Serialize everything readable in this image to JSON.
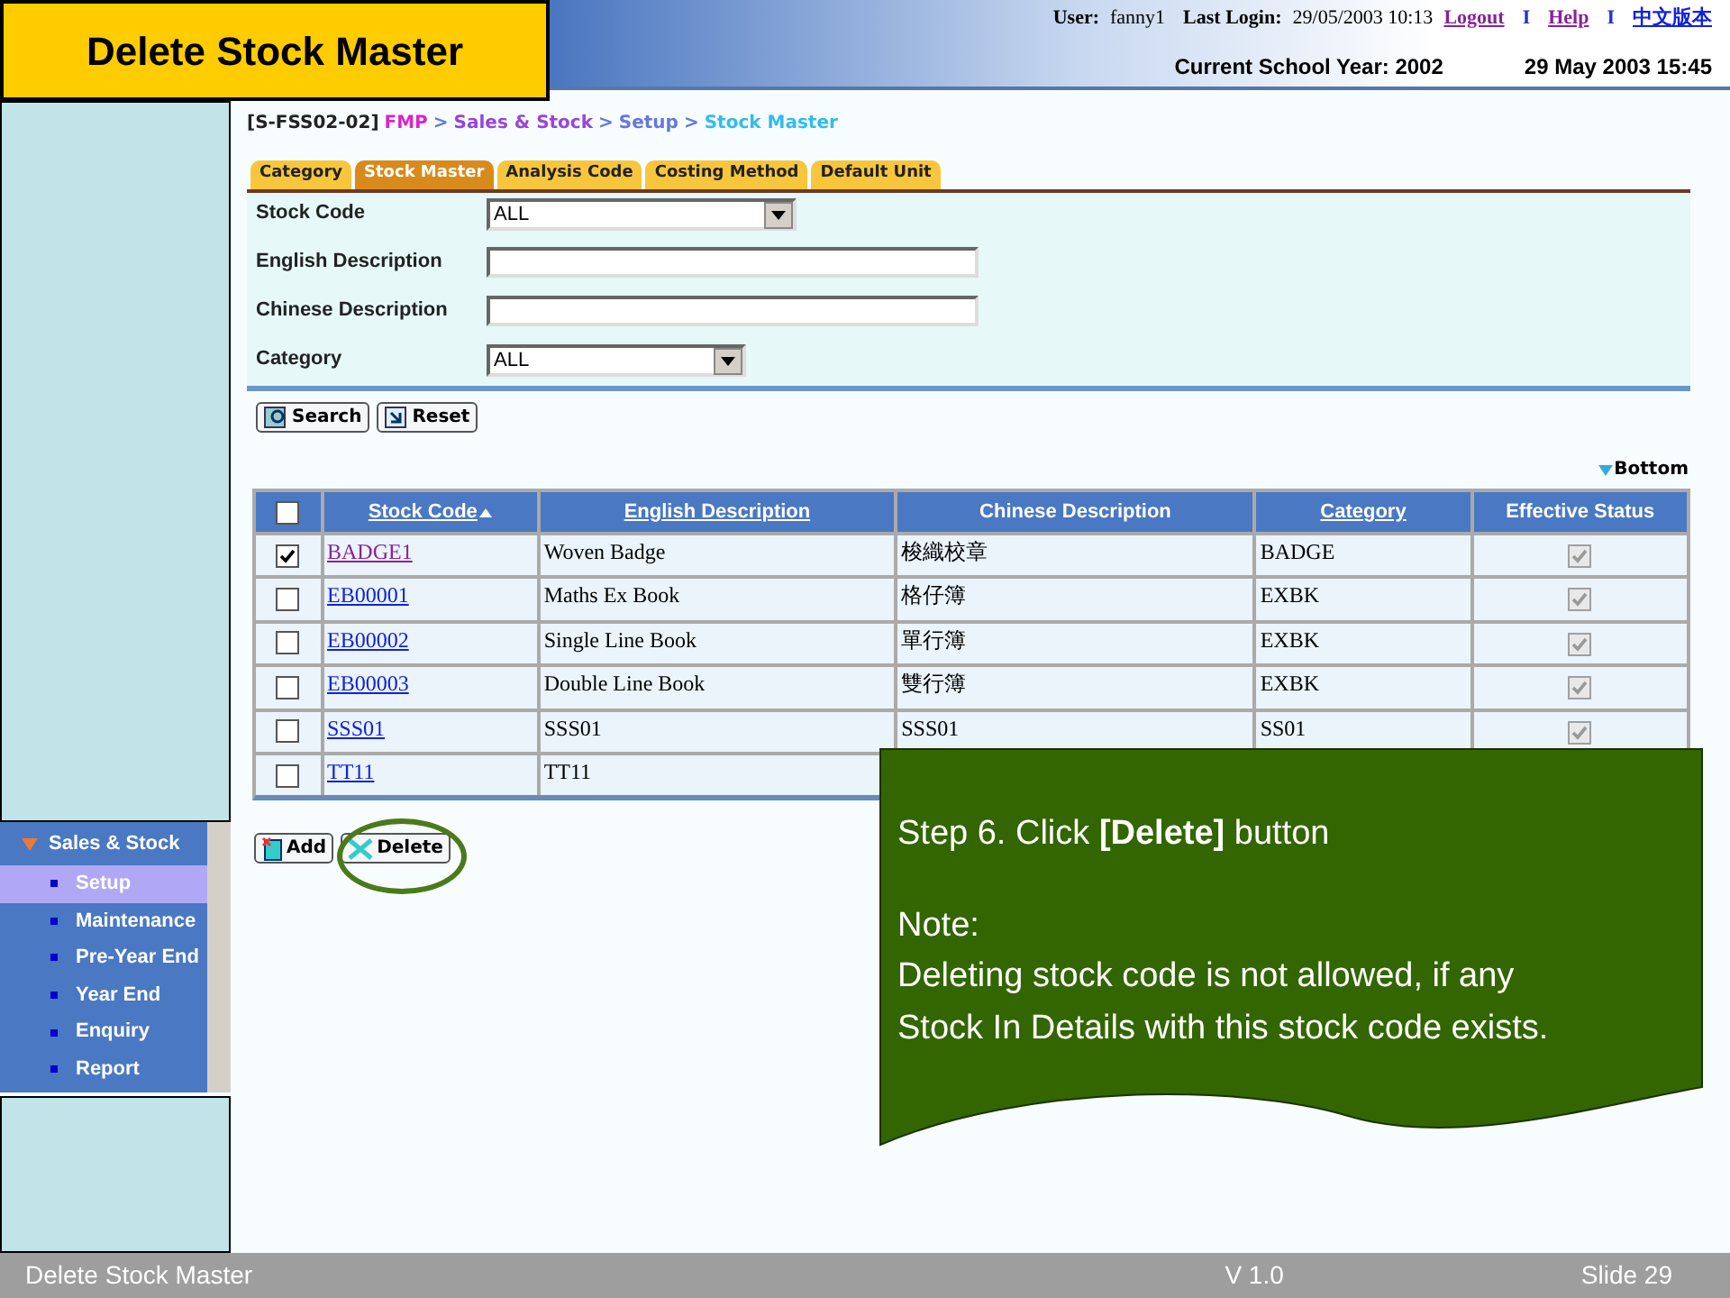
{
  "slide_title": "Delete Stock Master",
  "header": {
    "user_label": "User:",
    "user": "fanny1",
    "last_login_label": "Last Login:",
    "last_login": "29/05/2003 10:13",
    "links": [
      "Logout",
      "Help",
      "中文版本"
    ],
    "separators": [
      "I",
      "I"
    ],
    "school_year": "Current School Year: 2002",
    "datetime": "29 May 2003 15:45"
  },
  "breadcrumb": {
    "code": "[S-FSS02-02]",
    "separators": [
      ">",
      ">",
      ">"
    ],
    "path": [
      {
        "label": "FMP",
        "color": "#dd22cc"
      },
      {
        "label": "Sales & Stock",
        "color": "#9944dd"
      },
      {
        "label": "Setup",
        "color": "#6677dd"
      },
      {
        "label": "Stock Master",
        "color": "#33bbee"
      }
    ]
  },
  "tabs": [
    {
      "label": "Category",
      "selected": false
    },
    {
      "label": "Stock Master",
      "selected": true
    },
    {
      "label": "Analysis Code",
      "selected": false
    },
    {
      "label": "Costing Method",
      "selected": false
    },
    {
      "label": "Default Unit",
      "selected": false
    }
  ],
  "filters": [
    {
      "label": "Stock Code",
      "kind": "select",
      "value": "ALL"
    },
    {
      "label": "English Description",
      "kind": "text"
    },
    {
      "label": "Chinese Description",
      "kind": "text"
    },
    {
      "label": "Category",
      "kind": "select",
      "value": "ALL"
    }
  ],
  "filter_buttons": [
    "Search",
    "Reset"
  ],
  "bottom_link": "Bottom",
  "table": {
    "select_all_checked": false,
    "columns": [
      {
        "label": "Stock Code",
        "link": true,
        "sorted": true
      },
      {
        "label": "English Description",
        "link": true,
        "sorted": false
      },
      {
        "label": "Chinese Description",
        "link": false,
        "sorted": false
      },
      {
        "label": "Category",
        "link": true,
        "sorted": false
      },
      {
        "label": "Effective Status",
        "link": false,
        "sorted": false
      }
    ],
    "rows": [
      {
        "checked": true,
        "code": "BADGE1",
        "visited": true,
        "english": "Woven Badge",
        "chinese": "梭織校章",
        "category": "BADGE",
        "effective": true
      },
      {
        "checked": false,
        "code": "EB00001",
        "visited": false,
        "english": "Maths Ex Book",
        "chinese": "格仔簿",
        "category": "EXBK",
        "effective": true
      },
      {
        "checked": false,
        "code": "EB00002",
        "visited": false,
        "english": "Single Line Book",
        "chinese": "單行簿",
        "category": "EXBK",
        "effective": true
      },
      {
        "checked": false,
        "code": "EB00003",
        "visited": false,
        "english": "Double Line Book",
        "chinese": "雙行簿",
        "category": "EXBK",
        "effective": true
      },
      {
        "checked": false,
        "code": "SSS01",
        "visited": false,
        "english": "SSS01",
        "chinese": "SSS01",
        "category": "SS01",
        "effective": true
      },
      {
        "checked": false,
        "code": "TT11",
        "visited": false,
        "english": "TT11"
      }
    ]
  },
  "action_buttons": [
    "Add",
    "Delete"
  ],
  "sidebar": {
    "menu_title": "Sales & Stock",
    "items": [
      {
        "label": "Setup",
        "selected": true
      },
      {
        "label": "Maintenance",
        "selected": false
      },
      {
        "label": "Pre-Year End",
        "selected": false
      },
      {
        "label": "Year End",
        "selected": false
      },
      {
        "label": "Enquiry",
        "selected": false
      },
      {
        "label": "Report",
        "selected": false
      }
    ]
  },
  "callout": {
    "step": "Step 6. Click **[Delete]** button",
    "note_title": "Note:",
    "note": "Deleting stock code is not allowed, if any Stock In Details with this stock code exists."
  },
  "footer": {
    "title": "Delete Stock Master",
    "version": "V 1.0",
    "slide": "Slide 29"
  }
}
